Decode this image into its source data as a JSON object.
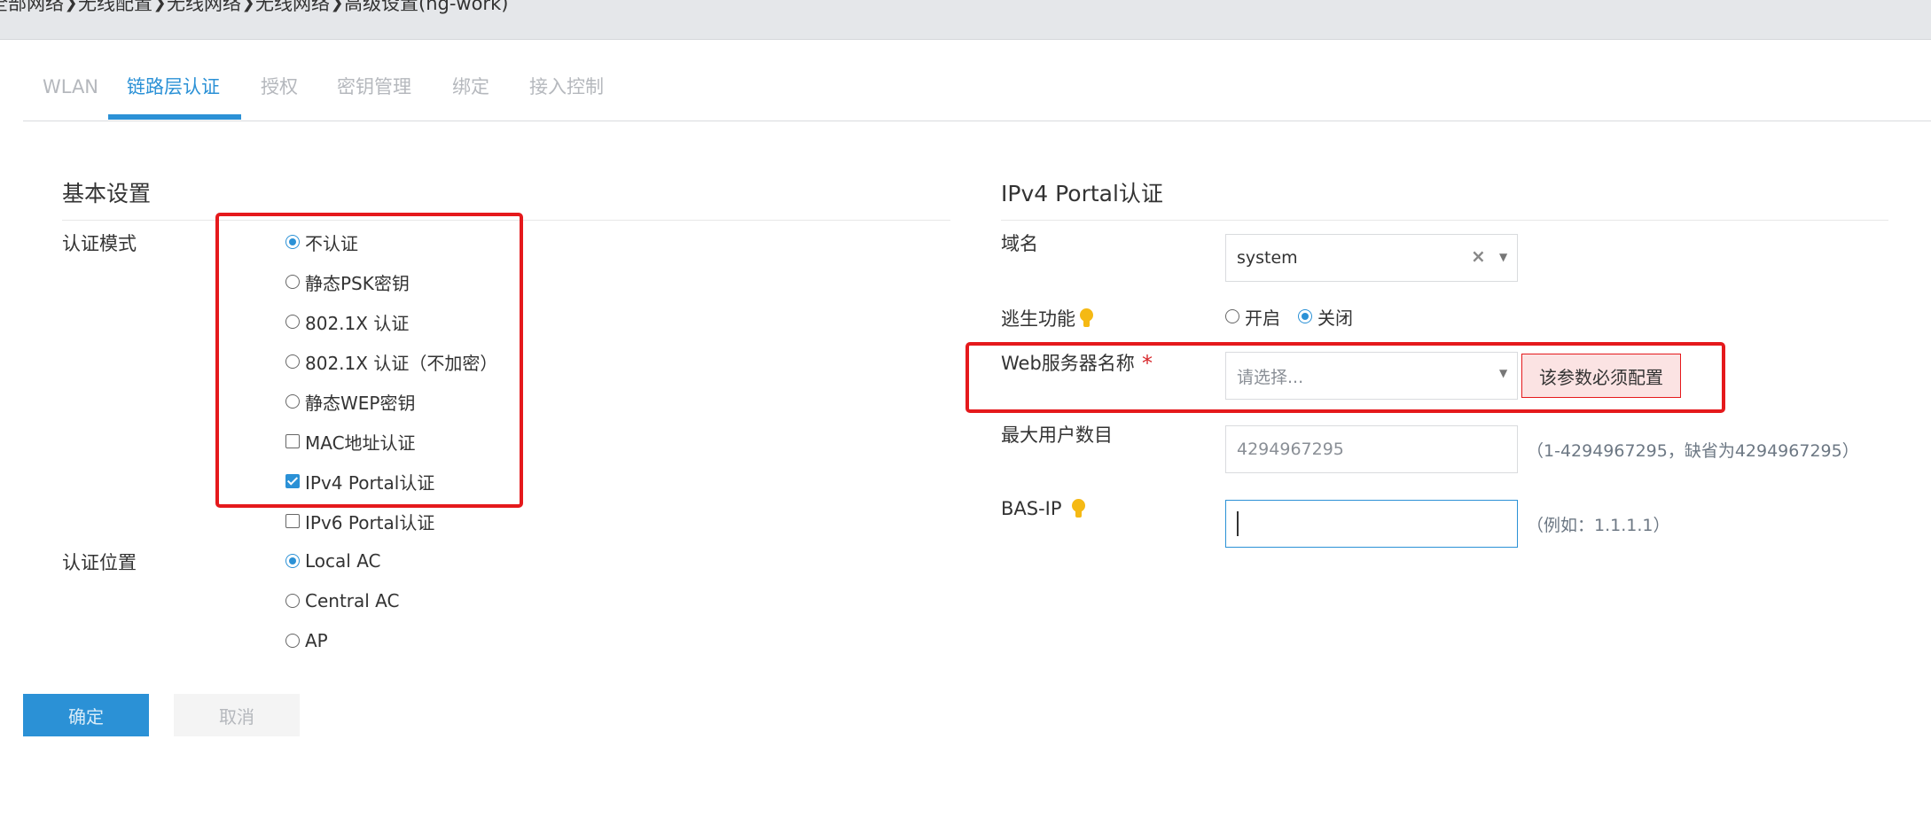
{
  "breadcrumb": [
    "全部网络",
    "无线配置",
    "无线网络",
    "无线网络",
    "高级设置(hg-work)"
  ],
  "tabs": [
    {
      "label": "WLAN",
      "active": false
    },
    {
      "label": "链路层认证",
      "active": true
    },
    {
      "label": "授权",
      "active": false
    },
    {
      "label": "密钥管理",
      "active": false
    },
    {
      "label": "绑定",
      "active": false
    },
    {
      "label": "接入控制",
      "active": false
    }
  ],
  "basic": {
    "title": "基本设置",
    "auth_mode_label": "认证模式",
    "auth_modes": [
      {
        "label": "不认证",
        "type": "radio",
        "checked": true
      },
      {
        "label": "静态PSK密钥",
        "type": "radio",
        "checked": false
      },
      {
        "label": "802.1X 认证",
        "type": "radio",
        "checked": false
      },
      {
        "label": "802.1X 认证（不加密）",
        "type": "radio",
        "checked": false
      },
      {
        "label": "静态WEP密钥",
        "type": "radio",
        "checked": false
      },
      {
        "label": "MAC地址认证",
        "type": "checkbox",
        "checked": false
      },
      {
        "label": "IPv4 Portal认证",
        "type": "checkbox",
        "checked": true
      },
      {
        "label": "IPv6 Portal认证",
        "type": "checkbox",
        "checked": false
      }
    ],
    "auth_location_label": "认证位置",
    "auth_locations": [
      {
        "label": "Local AC",
        "checked": true
      },
      {
        "label": "Central AC",
        "checked": false
      },
      {
        "label": "AP",
        "checked": false
      }
    ]
  },
  "portal": {
    "title": "IPv4 Portal认证",
    "domain_label": "域名",
    "domain_value": "system",
    "escape_label": "逃生功能",
    "escape_on": "开启",
    "escape_off": "关闭",
    "escape_selected": "关闭",
    "web_server_label": "Web服务器名称",
    "required_mark": "*",
    "web_server_placeholder": "请选择...",
    "web_server_error": "该参数必须配置",
    "max_users_label": "最大用户数目",
    "max_users_value": "4294967295",
    "max_users_hint": "（1-4294967295，缺省为4294967295）",
    "bas_ip_label": "BAS-IP",
    "bas_ip_value": "",
    "bas_ip_hint": "（例如：1.1.1.1）"
  },
  "buttons": {
    "ok": "确定",
    "cancel": "取消"
  },
  "colors": {
    "accent": "#2b91d6",
    "highlight_box": "#e5191c",
    "tip_icon": "#f5b914",
    "error_bg": "#fbe3e3"
  },
  "icons": {
    "breadcrumb_separator": "chevron-right-icon",
    "tip": "lightbulb-icon",
    "dropdown": "caret-down-icon",
    "clear": "clear-x-icon"
  }
}
